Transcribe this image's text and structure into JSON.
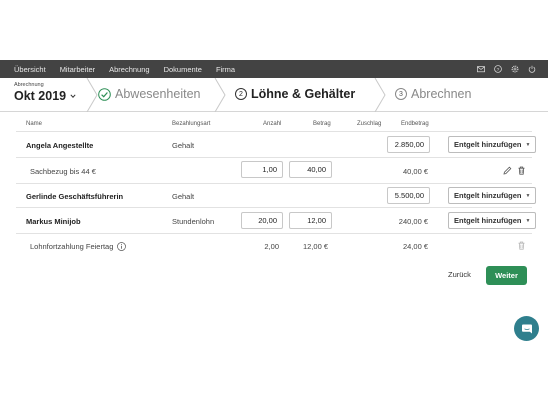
{
  "nav": {
    "items": [
      "Übersicht",
      "Mitarbeiter",
      "Abrechnung",
      "Dokumente",
      "Firma"
    ],
    "icons": [
      "mail-icon",
      "help-icon",
      "settings-icon",
      "power-icon"
    ]
  },
  "period": {
    "label": "Abrechnung",
    "value": "Okt 2019"
  },
  "steps": [
    {
      "label": "Abwesenheiten",
      "state": "done"
    },
    {
      "number": "2",
      "label": "Löhne & Gehälter",
      "state": "active"
    },
    {
      "number": "3",
      "label": "Abrechnen",
      "state": "pending"
    }
  ],
  "table": {
    "headers": {
      "name": "Name",
      "type": "Bezahlungsart",
      "count": "Anzahl",
      "amount": "Betrag",
      "surcharge": "Zuschlag",
      "total": "Endbetrag"
    },
    "add_button_label": "Entgelt hinzufügen",
    "rows": [
      {
        "name": "Angela Angestellte",
        "type": "Gehalt",
        "total": "2.850,00"
      },
      {
        "name": "Sachbezug bis 44 €",
        "count": "1,00",
        "amount": "40,00",
        "total": "40,00 €"
      },
      {
        "name": "Gerlinde Geschäftsführerin",
        "type": "Gehalt",
        "total": "5.500,00"
      },
      {
        "name": "Markus Minijob",
        "type": "Stundenlohn",
        "count": "20,00",
        "amount": "12,00",
        "total": "240,00 €"
      },
      {
        "name": "Lohnfortzahlung Feiertag",
        "count": "2,00",
        "amount": "12,00 €",
        "total": "24,00 €"
      }
    ]
  },
  "footer": {
    "back_label": "Zurück",
    "next_label": "Weiter"
  },
  "colors": {
    "nav_bg": "#434343",
    "primary": "#2e8f57",
    "chat": "#2f7f8d"
  }
}
